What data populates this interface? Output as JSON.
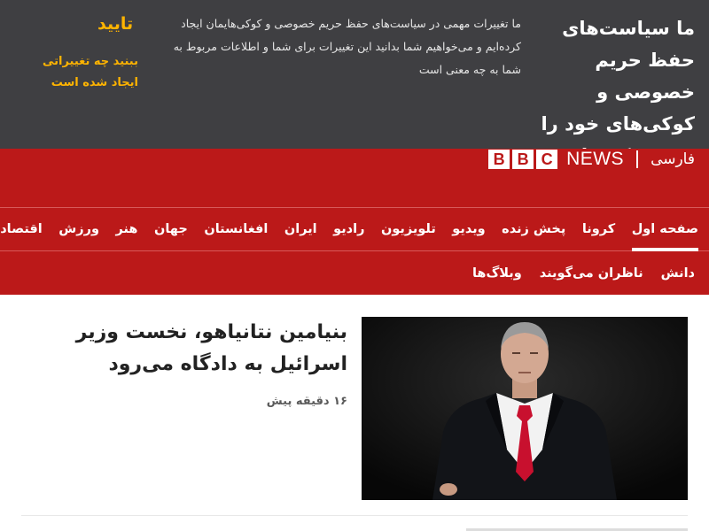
{
  "privacy_banner": {
    "title": "ما سیاست‌های حفظ حریم خصوصی و کوکی‌های خود را به روز کرده‌ایم",
    "body": "ما تغییرات مهمی در سیاست‌های حفظ حریم خصوصی و کوکی‌هایمان ایجاد کرده‌ایم و می‌خواهیم شما بدانید این تغییرات برای شما و اطلاعات مربوط به شما به چه معنی است",
    "accept_label": "تایید",
    "see_changes_label": "ببنید چه تغییراتی ایجاد شده است"
  },
  "header": {
    "brand_letters": [
      "B",
      "B",
      "C"
    ],
    "news_label": "NEWS",
    "service_label": "فارسی"
  },
  "nav": {
    "row1": [
      "صفحه اول",
      "کرونا",
      "پخش زنده",
      "ویدیو",
      "تلویزیون",
      "رادیو",
      "ایران",
      "افغانستان",
      "جهان",
      "هنر",
      "ورزش",
      "اقتصاد"
    ],
    "row2": [
      "دانش",
      "ناظران می‌گویند",
      "وبلاگ‌ها"
    ],
    "active": "صفحه اول"
  },
  "story": {
    "headline": "بنیامین نتانیاهو، نخست وزیر اسرائیل به دادگاه می‌رود",
    "time": "۱۶ دقیقه پیش"
  },
  "colors": {
    "brand_red": "#bb1919",
    "banner_bg": "#3f3f42",
    "accent_yellow": "#ffb400"
  }
}
